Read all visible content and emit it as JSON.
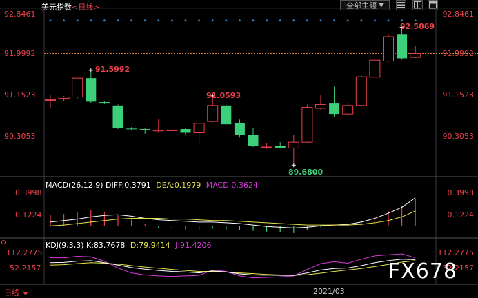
{
  "header": {
    "title": "美元指数",
    "period_link": "<日线>",
    "theme_select": "全部主题",
    "theme_arrow": "▼"
  },
  "colors": {
    "up": "#e8414a",
    "down": "#3cd07a",
    "dif": "#ffffff",
    "dea": "#e6e34a",
    "macd": "#d83ad8",
    "k": "#ffffff",
    "d": "#e6e34a",
    "j": "#d83ad8",
    "price_line": "#ff8c3a"
  },
  "price": {
    "ticks": [
      "92.8461",
      "91.9992",
      "91.1523",
      "90.3053"
    ],
    "current_price_tick": "91.9992",
    "annotations": {
      "high1": "91.5992",
      "high2": "91.0593",
      "high3": "92.5069",
      "low": "89.6800"
    }
  },
  "chart_data": {
    "type": "candlestick",
    "ylim": [
      89.45,
      92.93
    ],
    "candles": [
      {
        "o": 91.02,
        "h": 91.12,
        "l": 90.84,
        "c": 91.02
      },
      {
        "o": 91.05,
        "h": 91.1,
        "l": 91.0,
        "c": 91.08
      },
      {
        "o": 91.08,
        "h": 91.48,
        "l": 91.05,
        "c": 91.48
      },
      {
        "o": 91.48,
        "h": 91.6,
        "l": 90.95,
        "c": 90.98
      },
      {
        "o": 90.97,
        "h": 91.0,
        "l": 90.93,
        "c": 90.94
      },
      {
        "o": 90.9,
        "h": 90.92,
        "l": 90.4,
        "c": 90.42
      },
      {
        "o": 90.41,
        "h": 90.44,
        "l": 90.38,
        "c": 90.4
      },
      {
        "o": 90.4,
        "h": 90.43,
        "l": 90.3,
        "c": 90.39
      },
      {
        "o": 90.36,
        "h": 90.62,
        "l": 90.32,
        "c": 90.38
      },
      {
        "o": 90.38,
        "h": 90.4,
        "l": 90.34,
        "c": 90.38
      },
      {
        "o": 90.4,
        "h": 90.42,
        "l": 90.26,
        "c": 90.32
      },
      {
        "o": 90.32,
        "h": 90.52,
        "l": 90.08,
        "c": 90.52
      },
      {
        "o": 90.56,
        "h": 91.06,
        "l": 90.54,
        "c": 90.9
      },
      {
        "o": 90.9,
        "h": 90.92,
        "l": 90.5,
        "c": 90.5
      },
      {
        "o": 90.52,
        "h": 90.6,
        "l": 90.22,
        "c": 90.28
      },
      {
        "o": 90.28,
        "h": 90.42,
        "l": 90.02,
        "c": 90.04
      },
      {
        "o": 90.02,
        "h": 90.1,
        "l": 89.98,
        "c": 90.02
      },
      {
        "o": 90.04,
        "h": 90.12,
        "l": 89.99,
        "c": 90.0
      },
      {
        "o": 90.0,
        "h": 90.28,
        "l": 89.68,
        "c": 90.12
      },
      {
        "o": 90.12,
        "h": 90.92,
        "l": 90.1,
        "c": 90.86
      },
      {
        "o": 90.84,
        "h": 91.12,
        "l": 90.8,
        "c": 90.92
      },
      {
        "o": 90.94,
        "h": 91.3,
        "l": 90.66,
        "c": 90.72
      },
      {
        "o": 90.72,
        "h": 90.95,
        "l": 90.68,
        "c": 90.9
      },
      {
        "o": 90.9,
        "h": 91.54,
        "l": 90.87,
        "c": 91.51
      },
      {
        "o": 91.5,
        "h": 91.88,
        "l": 91.48,
        "c": 91.86
      },
      {
        "o": 91.84,
        "h": 92.4,
        "l": 91.82,
        "c": 92.36
      },
      {
        "o": 92.4,
        "h": 92.51,
        "l": 91.87,
        "c": 91.9
      },
      {
        "o": 91.92,
        "h": 92.16,
        "l": 91.9,
        "c": 92.0
      }
    ],
    "dotted_top_line": 92.7,
    "current_price": 91.9992
  },
  "macd": {
    "label": "MACD(26,12,9)",
    "diff": "DIFF:0.3791",
    "dea": "DEA:0.1979",
    "macd": "MACD:0.3624",
    "ticks": [
      "0.3998",
      "0.1224"
    ],
    "ylim": [
      -0.12,
      0.48
    ],
    "series_dif": [
      0.05,
      0.07,
      0.09,
      0.12,
      0.14,
      0.15,
      0.13,
      0.1,
      0.08,
      0.07,
      0.06,
      0.05,
      0.05,
      0.04,
      0.03,
      0.01,
      -0.01,
      -0.02,
      -0.03,
      -0.02,
      0.0,
      0.01,
      0.02,
      0.05,
      0.1,
      0.17,
      0.25,
      0.38
    ],
    "series_dea": [
      0.0,
      0.01,
      0.03,
      0.05,
      0.07,
      0.09,
      0.1,
      0.1,
      0.1,
      0.09,
      0.09,
      0.08,
      0.07,
      0.07,
      0.06,
      0.05,
      0.04,
      0.03,
      0.02,
      0.01,
      0.01,
      0.01,
      0.01,
      0.02,
      0.04,
      0.07,
      0.12,
      0.2
    ],
    "bars": [
      0.15,
      0.16,
      0.18,
      0.21,
      0.19,
      0.14,
      0.08,
      0.02,
      -0.03,
      -0.04,
      -0.05,
      -0.06,
      -0.04,
      -0.05,
      -0.06,
      -0.07,
      -0.08,
      -0.09,
      -0.1,
      -0.06,
      -0.02,
      0.01,
      0.03,
      0.07,
      0.12,
      0.2,
      0.27,
      0.36
    ]
  },
  "kdj": {
    "label": "KDJ(9,3,3)",
    "k": "K:83.7678",
    "d": "D:79.9414",
    "j": "J:91.4206",
    "ticks": [
      "112.2775",
      "52.2157"
    ],
    "ylim": [
      -5,
      125
    ],
    "series_k": [
      72,
      73,
      78,
      80,
      72,
      62,
      52,
      45,
      40,
      36,
      34,
      30,
      38,
      34,
      26,
      22,
      21,
      20,
      20,
      30,
      42,
      48,
      50,
      60,
      72,
      80,
      86,
      84
    ],
    "series_d": [
      62,
      64,
      68,
      72,
      70,
      66,
      60,
      54,
      49,
      44,
      40,
      36,
      36,
      34,
      30,
      27,
      24,
      22,
      20,
      23,
      29,
      36,
      42,
      48,
      56,
      65,
      74,
      80
    ],
    "series_j": [
      92,
      92,
      98,
      96,
      78,
      50,
      30,
      22,
      18,
      16,
      18,
      20,
      42,
      36,
      18,
      10,
      12,
      14,
      18,
      44,
      68,
      76,
      70,
      86,
      100,
      104,
      108,
      92
    ]
  },
  "footer": {
    "period": "日线",
    "date": "2021/03",
    "watermark": "FX678"
  }
}
